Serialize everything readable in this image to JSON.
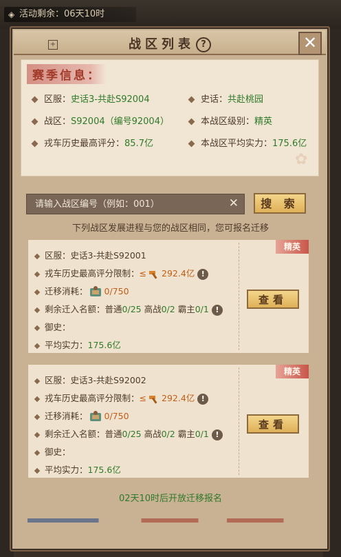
{
  "activity": {
    "label": "活动剩余：",
    "time": "06天10时"
  },
  "panel": {
    "title": "战区列表"
  },
  "season": {
    "title": "赛季信息：",
    "items": [
      {
        "label": "区服：",
        "value": "史话3-共赴S92004"
      },
      {
        "label": "史话：",
        "value": "共赴桃园"
      },
      {
        "label": "战区：",
        "value": "S92004（编号92004）"
      },
      {
        "label": "本战区级别：",
        "value": "精英"
      },
      {
        "label": "戎车历史最高评分：",
        "value": "85.7亿"
      },
      {
        "label": "本战区平均实力：",
        "value": "175.6亿"
      }
    ]
  },
  "search": {
    "placeholder": "请输入战区编号（例如：001）",
    "button_label": "搜 索"
  },
  "notice": "下列战区发展进程与您的战区相同，您可报名迁移",
  "cards": [
    {
      "badge": "精英",
      "server_label": "区服：",
      "server_value": "史话3-共赴S92001",
      "score_label": "戎车历史最高评分限制：",
      "score_op": "≤",
      "score_value": "292.4亿",
      "cost_label": "迁移消耗：",
      "cost_value": "0/750",
      "quota_label": "剩余迁入名额：",
      "quota_normal_label": "普通",
      "quota_normal": "0/25",
      "quota_high_label": "高战",
      "quota_high": "0/2",
      "quota_lord_label": "霸主",
      "quota_lord": "0/1",
      "history_label": "御史：",
      "history_value": "",
      "power_label": "平均实力：",
      "power_value": "175.6亿",
      "button_label": "查看"
    },
    {
      "badge": "精英",
      "server_label": "区服：",
      "server_value": "史话3-共赴S92002",
      "score_label": "戎车历史最高评分限制：",
      "score_op": "≤",
      "score_value": "292.4亿",
      "cost_label": "迁移消耗：",
      "cost_value": "0/750",
      "quota_label": "剩余迁入名额：",
      "quota_normal_label": "普通",
      "quota_normal": "0/25",
      "quota_high_label": "高战",
      "quota_high": "0/2",
      "quota_lord_label": "霸主",
      "quota_lord": "0/1",
      "history_label": "御史：",
      "history_value": "",
      "power_label": "平均实力：",
      "power_value": "175.6亿",
      "button_label": "查看"
    }
  ],
  "footer": "02天10时后开放迁移报名",
  "colors": {
    "accent_green": "#2f7a2a",
    "accent_red": "#a23b2b",
    "button_gold": "#dfb058"
  },
  "icons": [
    "clock-icon",
    "help-icon",
    "close-icon",
    "pin-icon",
    "hammer-icon",
    "scroll-icon",
    "warning-icon",
    "clear-icon"
  ]
}
